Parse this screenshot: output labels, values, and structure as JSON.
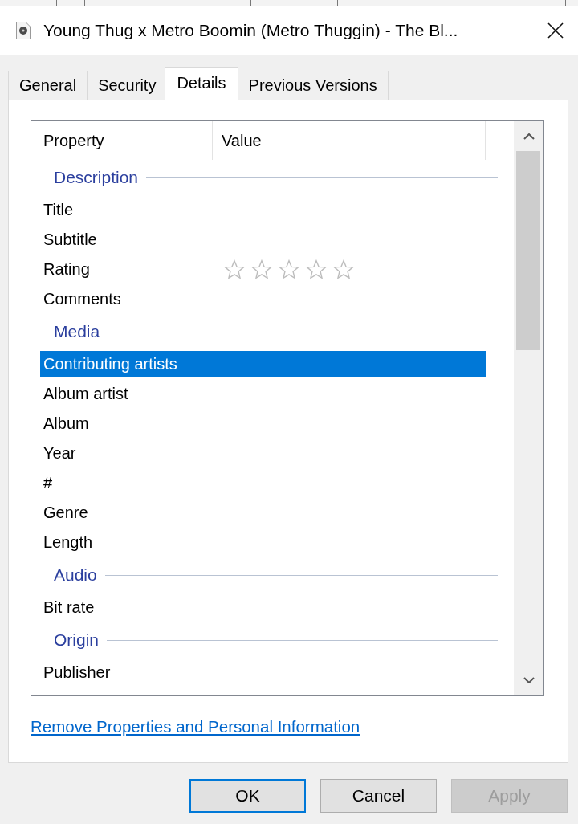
{
  "window": {
    "title": "Young Thug x Metro Boomin (Metro Thuggin) - The Bl..."
  },
  "tabs": [
    {
      "label": "General",
      "selected": false
    },
    {
      "label": "Security",
      "selected": false
    },
    {
      "label": "Details",
      "selected": true
    },
    {
      "label": "Previous Versions",
      "selected": false
    }
  ],
  "property_list": {
    "columns": [
      "Property",
      "Value"
    ],
    "groups": [
      {
        "name": "Description",
        "items": [
          {
            "label": "Title",
            "kind": "text",
            "selected": false
          },
          {
            "label": "Subtitle",
            "kind": "text",
            "selected": false
          },
          {
            "label": "Rating",
            "kind": "rating",
            "selected": false,
            "stars": 0
          },
          {
            "label": "Comments",
            "kind": "text",
            "selected": false
          }
        ]
      },
      {
        "name": "Media",
        "items": [
          {
            "label": "Contributing artists",
            "kind": "text",
            "selected": true
          },
          {
            "label": "Album artist",
            "kind": "text",
            "selected": false
          },
          {
            "label": "Album",
            "kind": "text",
            "selected": false
          },
          {
            "label": "Year",
            "kind": "text",
            "selected": false
          },
          {
            "label": "#",
            "kind": "text",
            "selected": false
          },
          {
            "label": "Genre",
            "kind": "text",
            "selected": false
          },
          {
            "label": "Length",
            "kind": "text",
            "selected": false
          }
        ]
      },
      {
        "name": "Audio",
        "items": [
          {
            "label": "Bit rate",
            "kind": "text",
            "selected": false
          }
        ]
      },
      {
        "name": "Origin",
        "items": [
          {
            "label": "Publisher",
            "kind": "text",
            "selected": false
          }
        ]
      }
    ]
  },
  "link": "Remove Properties and Personal Information",
  "buttons": [
    {
      "label": "OK",
      "default": true,
      "disabled": false
    },
    {
      "label": "Cancel",
      "default": false,
      "disabled": false
    },
    {
      "label": "Apply",
      "default": false,
      "disabled": true
    }
  ]
}
